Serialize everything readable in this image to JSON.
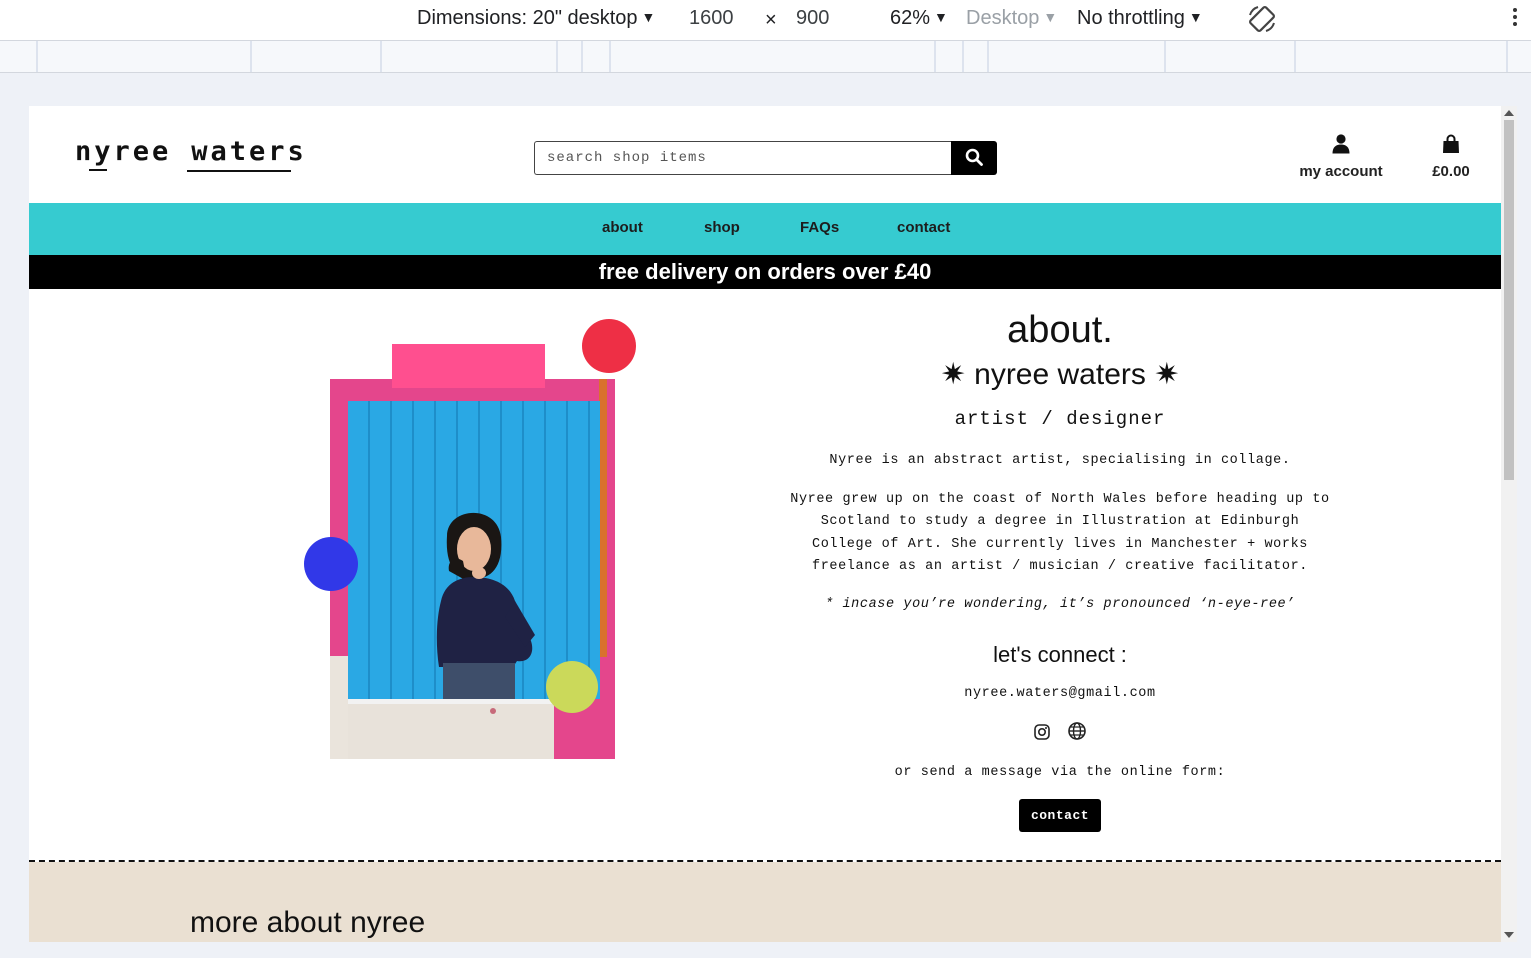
{
  "devtools": {
    "dimensions_label": "Dimensions: 20\" desktop",
    "width": "1600",
    "times": "×",
    "height": "900",
    "zoom": "62%",
    "device_type": "Desktop",
    "throttling": "No throttling"
  },
  "site": {
    "logo_first": "nyree",
    "logo_second": "waters",
    "search_placeholder": "search shop items",
    "account_label": "my account",
    "cart_total": "£0.00",
    "nav": [
      "about",
      "shop",
      "FAQs",
      "contact"
    ],
    "banner": "free delivery on orders over £40"
  },
  "about": {
    "heading": "about.",
    "name": "✷ nyree waters ✷",
    "role": "artist / designer",
    "intro": "Nyree is an abstract artist, specialising in collage.",
    "bio_lines": [
      "Nyree grew up on the coast of North Wales before heading up to",
      "Scotland to study a degree in Illustration at Edinburgh",
      "College of Art. She currently lives in Manchester + works",
      "freelance as an artist / musician / creative facilitator."
    ],
    "pronounce": "* incase you’re wondering, it’s pronounced ‘n-eye-ree’",
    "connect_heading": "let's connect :",
    "email": "nyree.waters@gmail.com",
    "social_icons": [
      "instagram-icon",
      "globe-icon"
    ],
    "form_text": "or send a message via the online form:",
    "contact_button": "contact"
  },
  "more": {
    "heading": "more about nyree"
  },
  "colors": {
    "nav_bg": "#36cbd0",
    "banner_bg": "#000000",
    "more_bg": "#eae0d2",
    "dot_red": "#ee2f45",
    "dot_blue": "#3138e8",
    "dot_green": "#cbd95a"
  }
}
